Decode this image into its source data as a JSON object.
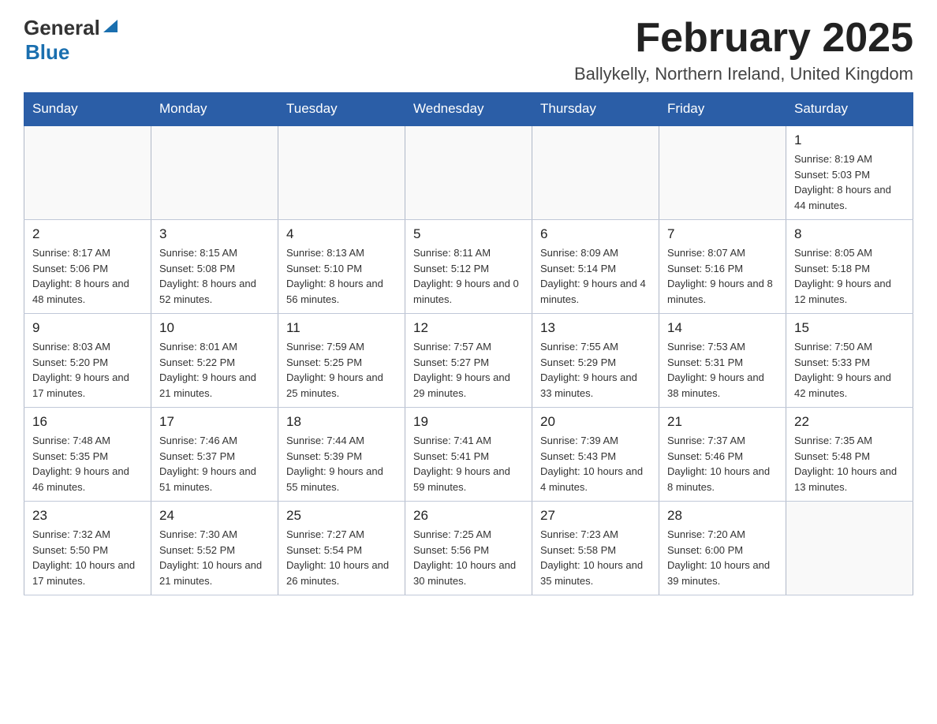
{
  "header": {
    "logo_general": "General",
    "logo_blue": "Blue",
    "month_title": "February 2025",
    "location": "Ballykelly, Northern Ireland, United Kingdom"
  },
  "days_of_week": [
    "Sunday",
    "Monday",
    "Tuesday",
    "Wednesday",
    "Thursday",
    "Friday",
    "Saturday"
  ],
  "weeks": [
    {
      "days": [
        {
          "num": "",
          "info": ""
        },
        {
          "num": "",
          "info": ""
        },
        {
          "num": "",
          "info": ""
        },
        {
          "num": "",
          "info": ""
        },
        {
          "num": "",
          "info": ""
        },
        {
          "num": "",
          "info": ""
        },
        {
          "num": "1",
          "info": "Sunrise: 8:19 AM\nSunset: 5:03 PM\nDaylight: 8 hours and 44 minutes."
        }
      ]
    },
    {
      "days": [
        {
          "num": "2",
          "info": "Sunrise: 8:17 AM\nSunset: 5:06 PM\nDaylight: 8 hours and 48 minutes."
        },
        {
          "num": "3",
          "info": "Sunrise: 8:15 AM\nSunset: 5:08 PM\nDaylight: 8 hours and 52 minutes."
        },
        {
          "num": "4",
          "info": "Sunrise: 8:13 AM\nSunset: 5:10 PM\nDaylight: 8 hours and 56 minutes."
        },
        {
          "num": "5",
          "info": "Sunrise: 8:11 AM\nSunset: 5:12 PM\nDaylight: 9 hours and 0 minutes."
        },
        {
          "num": "6",
          "info": "Sunrise: 8:09 AM\nSunset: 5:14 PM\nDaylight: 9 hours and 4 minutes."
        },
        {
          "num": "7",
          "info": "Sunrise: 8:07 AM\nSunset: 5:16 PM\nDaylight: 9 hours and 8 minutes."
        },
        {
          "num": "8",
          "info": "Sunrise: 8:05 AM\nSunset: 5:18 PM\nDaylight: 9 hours and 12 minutes."
        }
      ]
    },
    {
      "days": [
        {
          "num": "9",
          "info": "Sunrise: 8:03 AM\nSunset: 5:20 PM\nDaylight: 9 hours and 17 minutes."
        },
        {
          "num": "10",
          "info": "Sunrise: 8:01 AM\nSunset: 5:22 PM\nDaylight: 9 hours and 21 minutes."
        },
        {
          "num": "11",
          "info": "Sunrise: 7:59 AM\nSunset: 5:25 PM\nDaylight: 9 hours and 25 minutes."
        },
        {
          "num": "12",
          "info": "Sunrise: 7:57 AM\nSunset: 5:27 PM\nDaylight: 9 hours and 29 minutes."
        },
        {
          "num": "13",
          "info": "Sunrise: 7:55 AM\nSunset: 5:29 PM\nDaylight: 9 hours and 33 minutes."
        },
        {
          "num": "14",
          "info": "Sunrise: 7:53 AM\nSunset: 5:31 PM\nDaylight: 9 hours and 38 minutes."
        },
        {
          "num": "15",
          "info": "Sunrise: 7:50 AM\nSunset: 5:33 PM\nDaylight: 9 hours and 42 minutes."
        }
      ]
    },
    {
      "days": [
        {
          "num": "16",
          "info": "Sunrise: 7:48 AM\nSunset: 5:35 PM\nDaylight: 9 hours and 46 minutes."
        },
        {
          "num": "17",
          "info": "Sunrise: 7:46 AM\nSunset: 5:37 PM\nDaylight: 9 hours and 51 minutes."
        },
        {
          "num": "18",
          "info": "Sunrise: 7:44 AM\nSunset: 5:39 PM\nDaylight: 9 hours and 55 minutes."
        },
        {
          "num": "19",
          "info": "Sunrise: 7:41 AM\nSunset: 5:41 PM\nDaylight: 9 hours and 59 minutes."
        },
        {
          "num": "20",
          "info": "Sunrise: 7:39 AM\nSunset: 5:43 PM\nDaylight: 10 hours and 4 minutes."
        },
        {
          "num": "21",
          "info": "Sunrise: 7:37 AM\nSunset: 5:46 PM\nDaylight: 10 hours and 8 minutes."
        },
        {
          "num": "22",
          "info": "Sunrise: 7:35 AM\nSunset: 5:48 PM\nDaylight: 10 hours and 13 minutes."
        }
      ]
    },
    {
      "days": [
        {
          "num": "23",
          "info": "Sunrise: 7:32 AM\nSunset: 5:50 PM\nDaylight: 10 hours and 17 minutes."
        },
        {
          "num": "24",
          "info": "Sunrise: 7:30 AM\nSunset: 5:52 PM\nDaylight: 10 hours and 21 minutes."
        },
        {
          "num": "25",
          "info": "Sunrise: 7:27 AM\nSunset: 5:54 PM\nDaylight: 10 hours and 26 minutes."
        },
        {
          "num": "26",
          "info": "Sunrise: 7:25 AM\nSunset: 5:56 PM\nDaylight: 10 hours and 30 minutes."
        },
        {
          "num": "27",
          "info": "Sunrise: 7:23 AM\nSunset: 5:58 PM\nDaylight: 10 hours and 35 minutes."
        },
        {
          "num": "28",
          "info": "Sunrise: 7:20 AM\nSunset: 6:00 PM\nDaylight: 10 hours and 39 minutes."
        },
        {
          "num": "",
          "info": ""
        }
      ]
    }
  ]
}
